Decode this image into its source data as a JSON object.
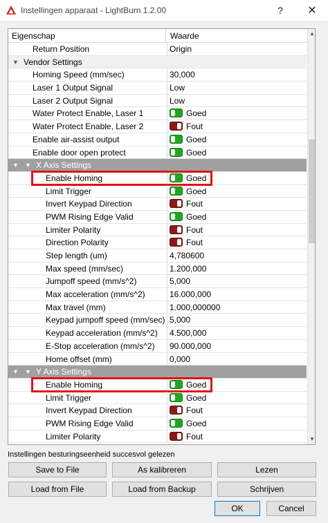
{
  "window": {
    "title": "Instellingen apparaat - LightBurn 1.2.00",
    "help_label": "?",
    "close_label": "✕"
  },
  "colors": {
    "toggle_on": "#1fa81f",
    "toggle_off": "#8a1a1a",
    "highlight": "#e01515",
    "subgroup_header": "#a0a0a0"
  },
  "grid": {
    "headers": {
      "property": "Eigenschap",
      "value": "Waarde"
    },
    "rows": [
      {
        "kind": "prop",
        "indent": 1,
        "name": "Return Position",
        "value": "Origin"
      },
      {
        "kind": "group",
        "indent": 0,
        "name": "Vendor Settings",
        "value": ""
      },
      {
        "kind": "prop",
        "indent": 1,
        "name": "Homing Speed (mm/sec)",
        "value": "30,000"
      },
      {
        "kind": "prop",
        "indent": 1,
        "name": "Laser 1 Output Signal",
        "value": "Low"
      },
      {
        "kind": "prop",
        "indent": 1,
        "name": "Laser 2 Output Signal",
        "value": "Low"
      },
      {
        "kind": "prop",
        "indent": 1,
        "name": "Water Protect Enable, Laser 1",
        "value": "Goed",
        "toggle": "on"
      },
      {
        "kind": "prop",
        "indent": 1,
        "name": "Water Protect Enable, Laser 2",
        "value": "Fout",
        "toggle": "off"
      },
      {
        "kind": "prop",
        "indent": 1,
        "name": "Enable air-assist output",
        "value": "Goed",
        "toggle": "on"
      },
      {
        "kind": "prop",
        "indent": 1,
        "name": "Enable door open protect",
        "value": "Goed",
        "toggle": "on"
      },
      {
        "kind": "subgroup",
        "indent": 1,
        "name": "X Axis Settings",
        "value": ""
      },
      {
        "kind": "prop",
        "indent": 2,
        "name": "Enable Homing",
        "value": "Goed",
        "toggle": "on",
        "highlight": true
      },
      {
        "kind": "prop",
        "indent": 2,
        "name": "Limit Trigger",
        "value": "Goed",
        "toggle": "on"
      },
      {
        "kind": "prop",
        "indent": 2,
        "name": "Invert Keypad Direction",
        "value": "Fout",
        "toggle": "off"
      },
      {
        "kind": "prop",
        "indent": 2,
        "name": "PWM Rising Edge Valid",
        "value": "Goed",
        "toggle": "on"
      },
      {
        "kind": "prop",
        "indent": 2,
        "name": "Limiter Polarity",
        "value": "Fout",
        "toggle": "off"
      },
      {
        "kind": "prop",
        "indent": 2,
        "name": "Direction Polarity",
        "value": "Fout",
        "toggle": "off"
      },
      {
        "kind": "prop",
        "indent": 2,
        "name": "Step length (um)",
        "value": "4,780600"
      },
      {
        "kind": "prop",
        "indent": 2,
        "name": "Max speed (mm/sec)",
        "value": "1.200,000"
      },
      {
        "kind": "prop",
        "indent": 2,
        "name": "Jumpoff speed (mm/s^2)",
        "value": "5,000"
      },
      {
        "kind": "prop",
        "indent": 2,
        "name": "Max acceleration (mm/s^2)",
        "value": "16.000,000"
      },
      {
        "kind": "prop",
        "indent": 2,
        "name": "Max travel (mm)",
        "value": "1.000,000000"
      },
      {
        "kind": "prop",
        "indent": 2,
        "name": "Keypad jumpoff speed (mm/sec)",
        "value": "5,000"
      },
      {
        "kind": "prop",
        "indent": 2,
        "name": "Keypad acceleration (mm/s^2)",
        "value": "4.500,000"
      },
      {
        "kind": "prop",
        "indent": 2,
        "name": "E-Stop acceleration (mm/s^2)",
        "value": "90.000,000"
      },
      {
        "kind": "prop",
        "indent": 2,
        "name": "Home offset (mm)",
        "value": "0,000"
      },
      {
        "kind": "subgroup",
        "indent": 1,
        "name": "Y Axis Settings",
        "value": ""
      },
      {
        "kind": "prop",
        "indent": 2,
        "name": "Enable Homing",
        "value": "Goed",
        "toggle": "on",
        "highlight": true
      },
      {
        "kind": "prop",
        "indent": 2,
        "name": "Limit Trigger",
        "value": "Goed",
        "toggle": "on"
      },
      {
        "kind": "prop",
        "indent": 2,
        "name": "Invert Keypad Direction",
        "value": "Fout",
        "toggle": "off"
      },
      {
        "kind": "prop",
        "indent": 2,
        "name": "PWM Rising Edge Valid",
        "value": "Goed",
        "toggle": "on"
      },
      {
        "kind": "prop",
        "indent": 2,
        "name": "Limiter Polarity",
        "value": "Fout",
        "toggle": "off"
      }
    ]
  },
  "status": {
    "text": "Instellingen besturingseenheid succesvol gelezen"
  },
  "buttons": {
    "save_to_file": "Save to File",
    "calibrate": "As kalibreren",
    "read": "Lezen",
    "load_from_file": "Load from File",
    "load_from_backup": "Load from Backup",
    "write": "Schrijven",
    "ok": "OK",
    "cancel": "Cancel"
  }
}
